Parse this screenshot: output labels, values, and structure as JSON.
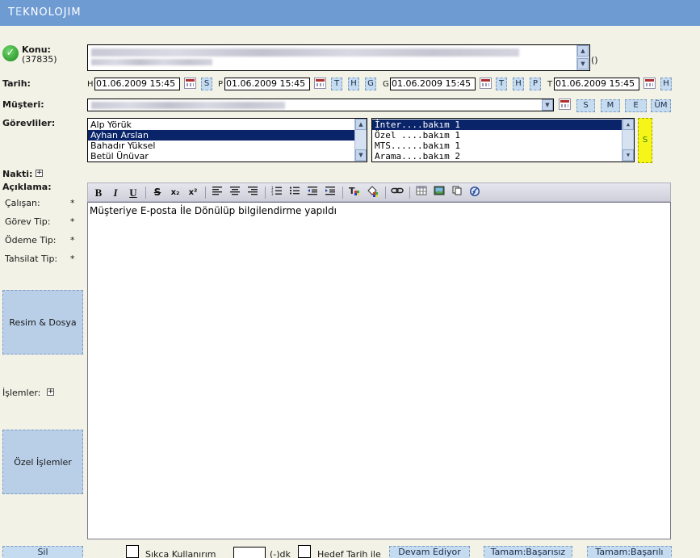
{
  "app": {
    "brand_part1": "T",
    "brand_part2": "E",
    "brand_part3": "KNOLOJIM"
  },
  "form": {
    "konu_label": "Konu:",
    "konu_id": "(37835)",
    "konu_suffix": "()",
    "tarih_label": "Tarih:",
    "date_fields": [
      {
        "prefix": "H",
        "value": "01.06.2009 15:45"
      },
      {
        "prefix": "P",
        "value": "01.06.2009 15:45"
      },
      {
        "prefix": "G",
        "value": "01.06.2009 15:45"
      },
      {
        "prefix": "T",
        "value": "01.06.2009 15:45"
      }
    ],
    "date_buttons": {
      "s": "S",
      "t1": "T",
      "h1": "H",
      "g": "G",
      "t2": "T",
      "h2": "H",
      "p": "P",
      "h3": "H"
    },
    "musteri_label": "Müşteri:",
    "musteri_buttons": {
      "s": "S",
      "m": "M",
      "e": "E",
      "um": "ÜM"
    },
    "gorevliler_label": "Görevliler:",
    "gorevliler": [
      "Alp Yörük",
      "Ayhan Arslan",
      "Bahadır Yüksel",
      "Betül Ünüvar"
    ],
    "tasks": [
      "İnter....bakım 1",
      "Özel ....bakım 1",
      "MTS......bakım 1",
      "Arama....bakım 2"
    ],
    "yellow_label": "S",
    "nakti_label": "Nakti:",
    "aciklama_label": "Açıklama:",
    "calisan_label": "Çalışan:",
    "gorev_tip_label": "Görev Tip:",
    "odeme_tip_label": "Ödeme Tip:",
    "tahsilat_tip_label": "Tahsilat Tip:",
    "star": "*",
    "resim_dosya": "Resim & Dosya",
    "islemler_label": "İşlemler:",
    "ozel_islemler": "Özel İşlemler",
    "editor_text": "Müşteriye E-posta İle Dönülüp bilgilendirme yapıldı"
  },
  "toolbar": {
    "bold": "B",
    "italic": "I",
    "underline": "U",
    "strike": "S",
    "sub": "x₂",
    "sup": "x²"
  },
  "bottom": {
    "sil": "Sil",
    "sikca": "Sıkca Kullanırım",
    "dk": "(-)dk",
    "hedef": "Hedef Tarih ile",
    "devam": "Devam Ediyor",
    "basarisiz": "Tamam:Başarısız",
    "basarili": "Tamam:Başarılı"
  },
  "colors": {
    "header": "#6f9bd3",
    "selection": "#0a246a",
    "page_bg": "#f2f2e6"
  }
}
